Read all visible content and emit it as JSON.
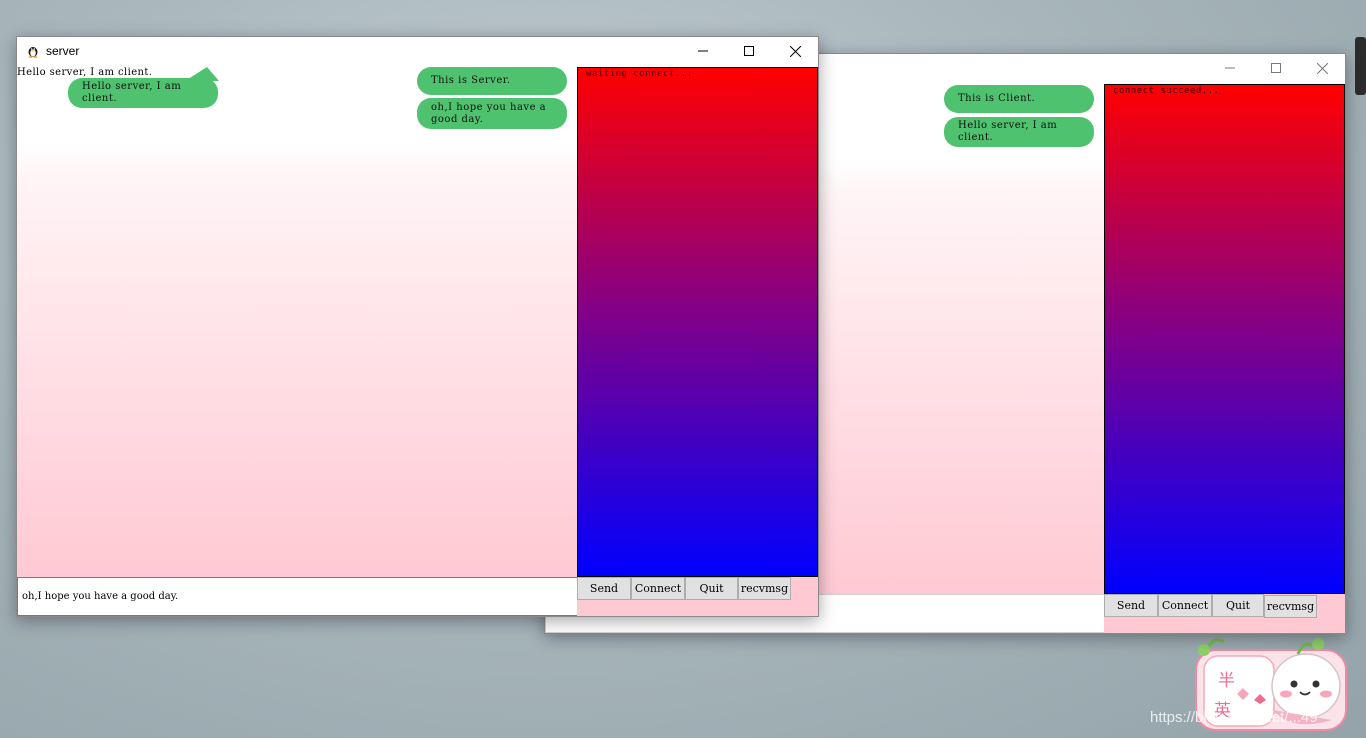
{
  "client_window": {
    "messages": {
      "sent": [
        "This is Client.",
        "Hello server, I am client."
      ]
    },
    "status": "connect succeed...",
    "input_value": "",
    "buttons": {
      "send": "Send",
      "connect": "Connect",
      "quit": "Quit",
      "recvmsg": "recvmsg"
    }
  },
  "server_window": {
    "title": "server",
    "messages": {
      "received_plain": "Hello server, I am client.",
      "received_bubble": "Hello server, I am client.",
      "sent": [
        "This is Server.",
        "oh,I hope you have a good day."
      ]
    },
    "status": "waiting connect...",
    "input_value": "oh,I hope you have a good day.",
    "buttons": {
      "send": "Send",
      "connect": "Connect",
      "quit": "Quit",
      "recvmsg": "recvmsg"
    }
  },
  "sticker": {
    "chars": [
      "半",
      "英"
    ]
  },
  "watermark": "https://blog.csdn.net/...49",
  "colors": {
    "bubble_green": "#4fc26f",
    "panel_top": "#ff0000",
    "panel_mid": "#8a0080",
    "panel_bottom": "#0000ff",
    "pink": "#ffc9d3"
  }
}
